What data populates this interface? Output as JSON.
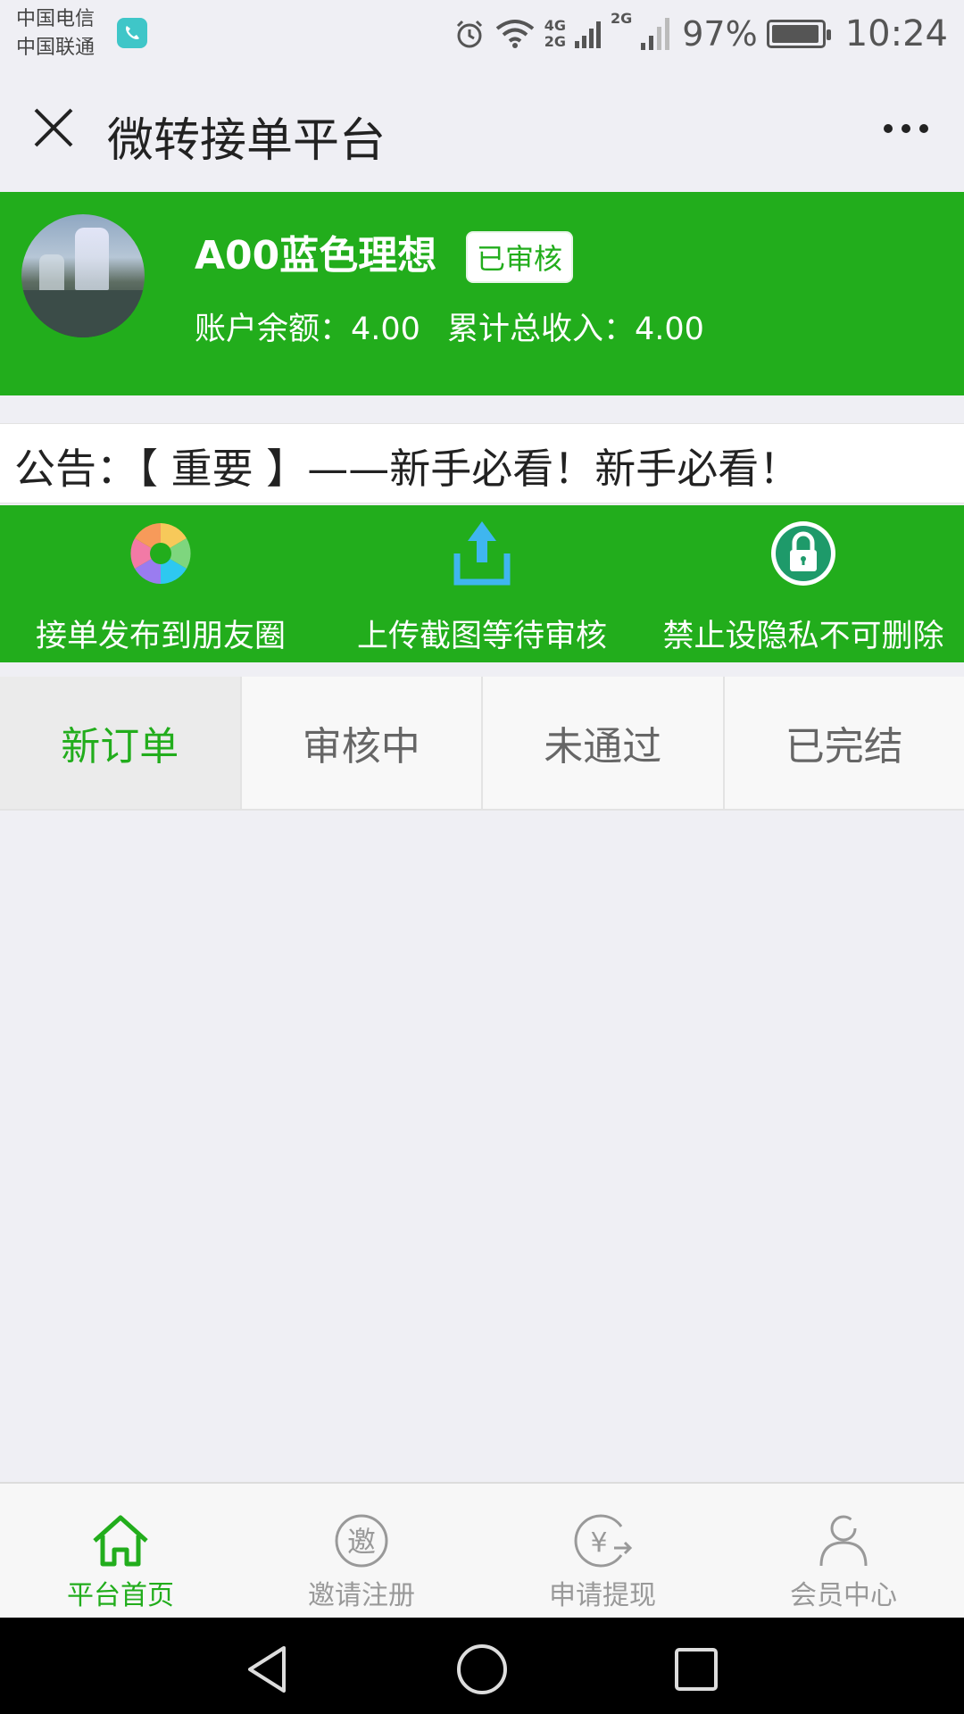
{
  "status_bar": {
    "carrier1": "中国电信",
    "carrier2": "中国联通",
    "net_4g": "4G",
    "net_2g_a": "2G",
    "net_2g_b": "2G",
    "battery_pct": "97%",
    "battery_level": 0.97,
    "time": "10:24",
    "icons": [
      "call-app-icon",
      "alarm-icon",
      "wifi-icon",
      "signal-icon",
      "battery-icon"
    ]
  },
  "titlebar": {
    "title": "微转接单平台",
    "close_icon": "close-icon",
    "more_icon": "more-icon"
  },
  "profile": {
    "username": "A00蓝色理想",
    "badge": "已审核",
    "balance_label": "账户余额：",
    "balance_value": "4.00",
    "income_label": "累计总收入：",
    "income_value": "4.00"
  },
  "notice": {
    "text": "公告：【 重要 】——新手必看！新手必看！"
  },
  "steps": [
    {
      "label": "接单发布到朋友圈",
      "icon": "aperture-icon"
    },
    {
      "label": "上传截图等待审核",
      "icon": "upload-icon"
    },
    {
      "label": "禁止设隐私不可删除",
      "icon": "lock-icon"
    }
  ],
  "tabs": [
    {
      "label": "新订单",
      "active": true
    },
    {
      "label": "审核中",
      "active": false
    },
    {
      "label": "未通过",
      "active": false
    },
    {
      "label": "已完结",
      "active": false
    }
  ],
  "bottom_nav": [
    {
      "label": "平台首页",
      "icon": "home-icon",
      "active": true
    },
    {
      "label": "邀请注册",
      "icon": "invite-icon",
      "icon_text": "邀",
      "active": false
    },
    {
      "label": "申请提现",
      "icon": "withdraw-icon",
      "icon_text": "¥",
      "active": false
    },
    {
      "label": "会员中心",
      "icon": "user-icon",
      "active": false
    }
  ],
  "colors": {
    "brand_green": "#22ad1c",
    "background": "#efeff4",
    "inactive_gray": "#999999"
  }
}
